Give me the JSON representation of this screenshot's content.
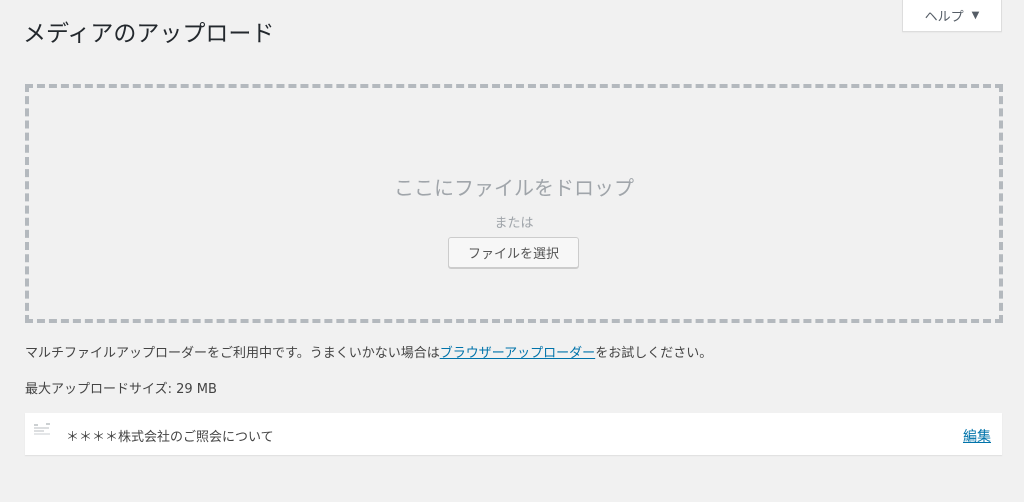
{
  "help_tab": {
    "label": "ヘルプ",
    "arrow_icon": "triangle-down-icon"
  },
  "page_title": "メディアのアップロード",
  "dropzone": {
    "title": "ここにファイルをドロップ",
    "or_text": "または",
    "select_button": "ファイルを選択"
  },
  "info": {
    "text_before": "マルチファイルアップローダーをご利用中です。うまくいかない場合は",
    "link_text": "ブラウザーアップローダー",
    "text_after": "をお試しください。"
  },
  "max_upload": "最大アップロードサイズ: 29 MB",
  "media_items": [
    {
      "title": "＊＊＊＊株式会社のご照会について",
      "edit_label": "編集",
      "thumbnail_icon": "document-thumbnail-icon"
    }
  ],
  "colors": {
    "accent": "#0073aa",
    "background": "#f1f1f1",
    "dashed_border": "#b4b9be"
  }
}
